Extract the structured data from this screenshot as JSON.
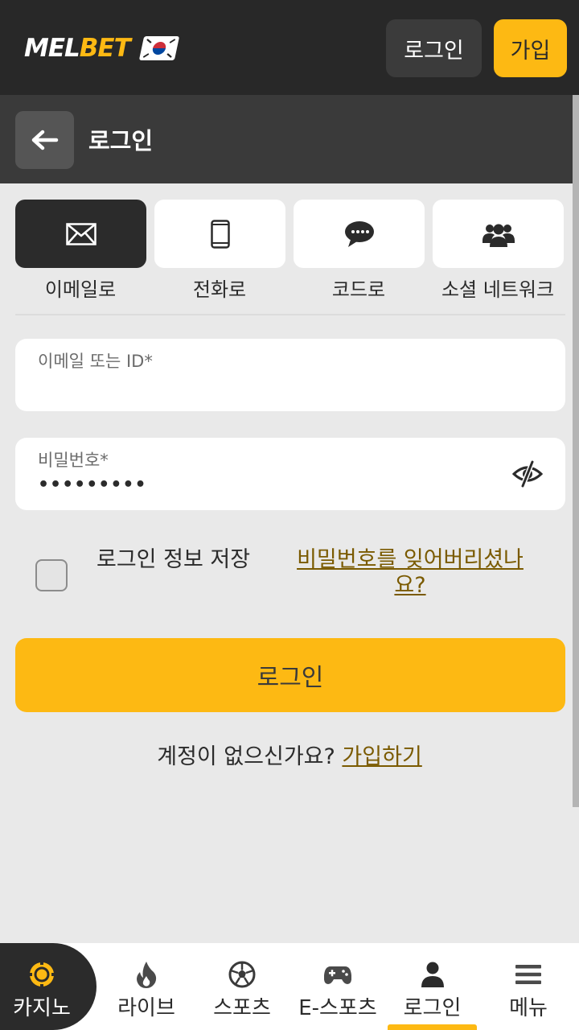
{
  "header": {
    "logo_part1": "MEL",
    "logo_part2": "BET",
    "login_button": "로그인",
    "join_button": "가입"
  },
  "subheader": {
    "title": "로그인"
  },
  "tabs": [
    {
      "label": "이메일로",
      "icon": "envelope-icon",
      "active": true
    },
    {
      "label": "전화로",
      "icon": "phone-icon",
      "active": false
    },
    {
      "label": "코드로",
      "icon": "chat-bubble-icon",
      "active": false
    },
    {
      "label": "소셜 네트워크",
      "icon": "users-icon",
      "active": false
    }
  ],
  "form": {
    "email_label": "이메일 또는 ID*",
    "email_value": "",
    "password_label": "비밀번호*",
    "password_value": "•••••••••",
    "remember_label": "로그인 정보 저장",
    "remember_checked": false,
    "forgot_link": "비밀번호를 잊어버리셨나요?",
    "submit_button": "로그인"
  },
  "register": {
    "prompt": "계정이 없으신가요? ",
    "link": "가입하기"
  },
  "bottom_nav": [
    {
      "label": "카지노",
      "icon": "casino-chip-icon"
    },
    {
      "label": "라이브",
      "icon": "flame-icon"
    },
    {
      "label": "스포츠",
      "icon": "soccer-ball-icon"
    },
    {
      "label": "E-스포츠",
      "icon": "gamepad-icon"
    },
    {
      "label": "로그인",
      "icon": "user-icon",
      "active": true
    },
    {
      "label": "메뉴",
      "icon": "hamburger-menu-icon"
    }
  ],
  "colors": {
    "accent": "#fdb913",
    "header_bg": "#282828",
    "subheader_bg": "#3a3a3a",
    "page_bg": "#e9e9e9",
    "link": "#7a5a00"
  }
}
